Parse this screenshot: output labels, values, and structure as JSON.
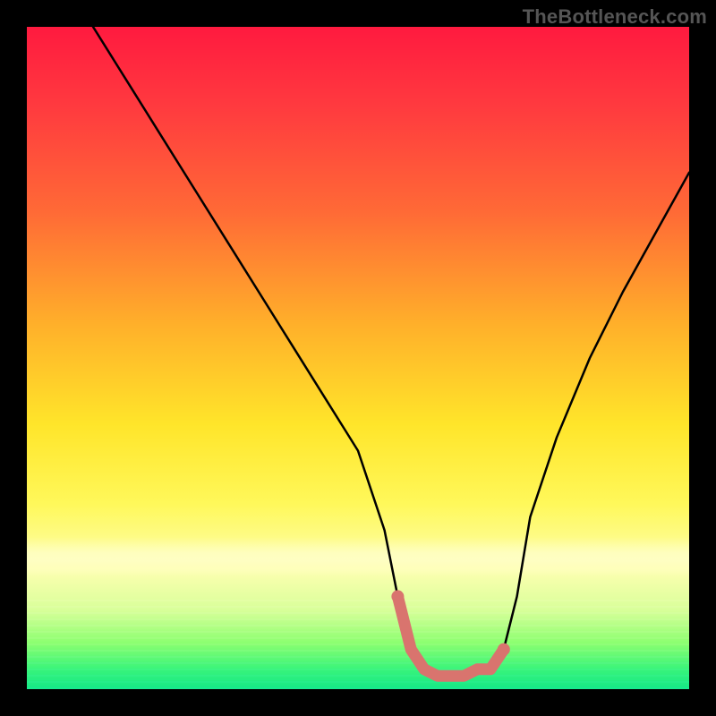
{
  "watermark": "TheBottleneck.com",
  "chart_data": {
    "type": "line",
    "title": "",
    "xlabel": "",
    "ylabel": "",
    "xlim": [
      0,
      100
    ],
    "ylim": [
      0,
      100
    ],
    "grid": false,
    "legend": false,
    "series": [
      {
        "name": "bottleneck-curve",
        "x": [
          10,
          15,
          20,
          25,
          30,
          35,
          40,
          45,
          50,
          54,
          56,
          58,
          60,
          62,
          64,
          66,
          68,
          70,
          72,
          74,
          76,
          80,
          85,
          90,
          95,
          100
        ],
        "y": [
          100,
          92,
          84,
          76,
          68,
          60,
          52,
          44,
          36,
          24,
          14,
          6,
          3,
          2,
          2,
          2,
          3,
          3,
          6,
          14,
          26,
          38,
          50,
          60,
          69,
          78
        ]
      }
    ],
    "highlight_segment": {
      "name": "optimal-range-marker",
      "color": "#d9746e",
      "x": [
        56,
        58,
        60,
        62,
        64,
        66,
        68,
        70,
        72
      ],
      "y": [
        14,
        6,
        3,
        2,
        2,
        2,
        3,
        3,
        6
      ]
    },
    "gradient_meaning": "color = bottleneck severity; green (bottom) = balanced, red (top) = severe bottleneck",
    "color_stops": [
      {
        "pos": 0.0,
        "hex": "#ff1a3f"
      },
      {
        "pos": 0.28,
        "hex": "#ff6a36"
      },
      {
        "pos": 0.6,
        "hex": "#ffe52a"
      },
      {
        "pos": 0.82,
        "hex": "#fdffb0"
      },
      {
        "pos": 1.0,
        "hex": "#15e887"
      }
    ]
  }
}
